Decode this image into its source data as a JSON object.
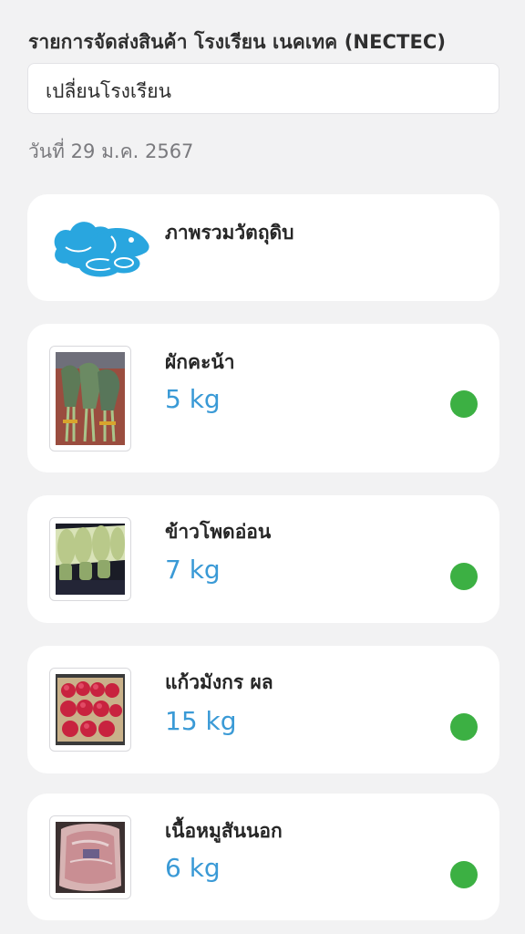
{
  "header": {
    "title": "รายการจัดส่งสินค้า โรงเรียน เนคเทค (NECTEC)",
    "change_school_label": "เปลี่ยนโรงเรียน",
    "date_label": "วันที่ 29 ม.ค. 2567"
  },
  "overview": {
    "label": "ภาพรวมวัตถุดิบ",
    "icon": "raw-ingredients-icon",
    "icon_color": "#29a6df"
  },
  "status_color": "#3cb043",
  "qty_color": "#3a9ad6",
  "items": [
    {
      "name": "ผักคะน้า",
      "qty": "5 kg",
      "image": "kale-photo",
      "status": "delivered"
    },
    {
      "name": "ข้าวโพดอ่อน",
      "qty": "7 kg",
      "image": "baby-corn-photo",
      "status": "delivered"
    },
    {
      "name": "แก้วมังกร ผล",
      "qty": "15 kg",
      "image": "dragon-fruit-photo",
      "status": "delivered"
    },
    {
      "name": "เนื้อหมูสันนอก",
      "qty": "6 kg",
      "image": "pork-loin-photo",
      "status": "delivered"
    }
  ]
}
